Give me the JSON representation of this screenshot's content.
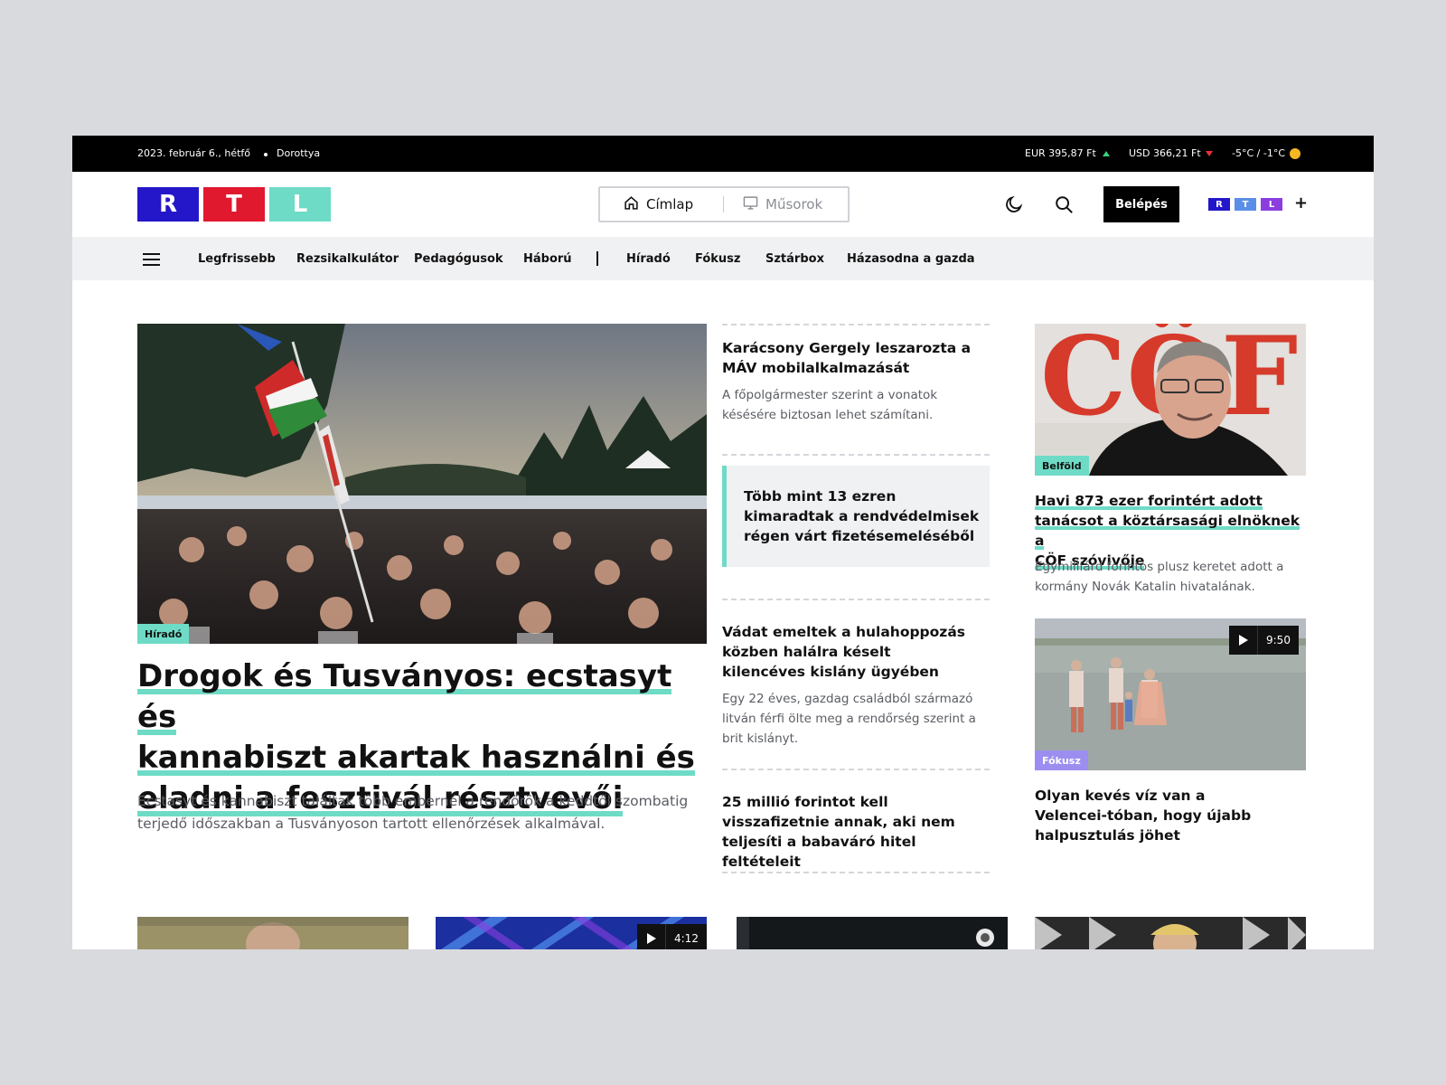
{
  "topbar": {
    "date": "2023. február 6., hétfő",
    "nameday": "Dorottya",
    "eur": "EUR 395,87 Ft",
    "usd": "USD 366,21 Ft",
    "weather": "-5°C / -1°C"
  },
  "header": {
    "logo": [
      "R",
      "T",
      "L"
    ],
    "tabs": [
      {
        "label": "Címlap",
        "icon": "home-icon"
      },
      {
        "label": "Műsorok",
        "icon": "monitor-icon"
      }
    ],
    "login_label": "Belépés",
    "rtlplus": [
      "R",
      "T",
      "L",
      "+"
    ],
    "colors": {
      "r": "#2417c9",
      "t": "#e0192e",
      "l": "#6edbc6",
      "accent": "#6edbc6"
    }
  },
  "nav": {
    "items": [
      "Legfrissebb",
      "Rezsikalkulátor",
      "Pedagógusok",
      "Háború",
      "Híradó",
      "Fókusz",
      "Sztárbox",
      "Házasodna a gazda"
    ]
  },
  "main": {
    "tag": "Híradó",
    "title_lines": [
      "Drogok és Tusványos: ecstasyt és",
      "kannabiszt akartak használni és",
      "eladni a fesztivál résztvevői"
    ],
    "lead": "Ecstasyt és kannabiszt találtak több embernél a rendőrök a keddtől szombatig terjedő időszakban a Tusványoson tartott ellenőrzések alkalmával."
  },
  "middle": [
    {
      "title": "Karácsony Gergely leszarozta a MÁV mobilalkalmazását",
      "lead": "A főpolgármester szerint a vonatok késésére biztosan lehet számítani."
    },
    {
      "title": "Több mint 13 ezren kimaradtak a rendvédelmisek régen várt fizetésemeléséből"
    },
    {
      "title": "Vádat emeltek a hulahoppozás közben halálra késelt kilencéves kislány ügyében",
      "lead": "Egy 22 éves, gazdag családból származó litván férfi ölte meg a rendőrség szerint a brit kislányt."
    },
    {
      "title": "25 millió forintot kell visszafizetnie annak, aki nem teljesíti a babaváró hitel feltételeit"
    }
  ],
  "right": [
    {
      "tag": "Belföld",
      "title_lines": [
        "Havi 873 ezer forintért adott",
        "tanácsot a köztársasági elnöknek a",
        "CÖF szóvivője"
      ],
      "lead": "Egymilliárd forintos plusz keretet adott a kormány Novák Katalin hivatalának.",
      "image_text": "CÖF"
    },
    {
      "tag": "Fókusz",
      "duration": "9:50",
      "title": "Olyan kevés víz van a Velencei-tóban, hogy újabb halpusztulás jöhet"
    }
  ],
  "bottom": [
    {
      "duration": ""
    },
    {
      "duration": "4:12"
    },
    {
      "duration": ""
    },
    {
      "duration": ""
    }
  ]
}
